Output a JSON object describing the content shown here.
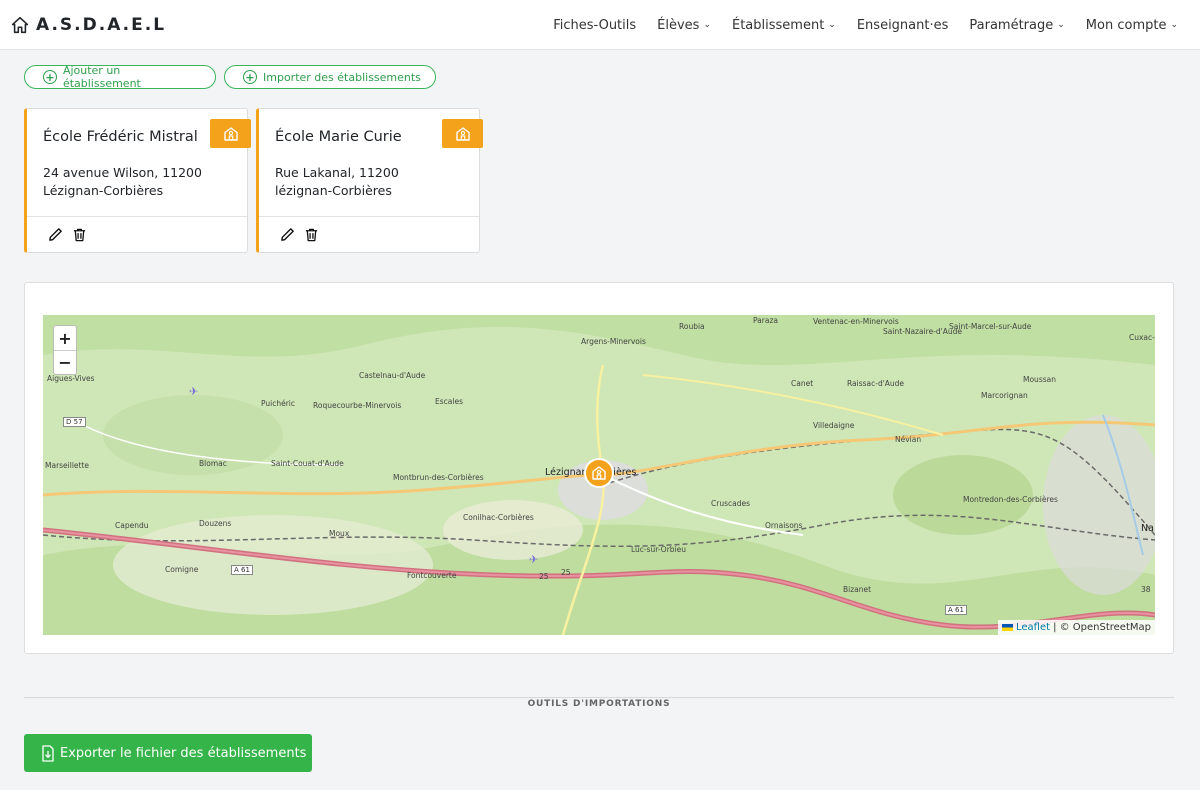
{
  "brand": {
    "title": "A.S.D.A.E.L"
  },
  "nav": [
    {
      "label": "Fiches-Outils",
      "dropdown": false
    },
    {
      "label": "Élèves",
      "dropdown": true
    },
    {
      "label": "Établissement",
      "dropdown": true
    },
    {
      "label": "Enseignant·es",
      "dropdown": false
    },
    {
      "label": "Paramétrage",
      "dropdown": true
    },
    {
      "label": "Mon compte",
      "dropdown": true
    }
  ],
  "actions": {
    "add_label": "Ajouter un établissement",
    "import_label": "Importer des établissements"
  },
  "schools": [
    {
      "name": "École Frédéric Mistral",
      "address": "24 avenue Wilson, 11200 Lézignan-Corbières"
    },
    {
      "name": "École Marie Curie",
      "address": "Rue Lakanal, 11200 lézignan-Corbières"
    }
  ],
  "map": {
    "zoom_in": "+",
    "zoom_out": "−",
    "attribution_link": "Leaflet",
    "attribution_text": "| © OpenStreetMap",
    "places": [
      "Roubia",
      "Argens-Minervois",
      "Ventenac-en-Minervois",
      "Paraza",
      "Saint-Nazaire-d'Aude",
      "Saint-Marcel-sur-Aude",
      "Cuxac-",
      "Aigues-Vives",
      "Castelnau-d'Aude",
      "Puichéric",
      "Roquecourbe-Minervois",
      "Escales",
      "Canet",
      "Raissac-d'Aude",
      "Moussan",
      "Marcorignan",
      "Villedaigne",
      "Névian",
      "Marseillette",
      "Blomac",
      "Saint-Couat-d'Aude",
      "Montbrun-des-Corbières",
      "Lézignan-Corbières",
      "Cruscades",
      "Ornaisons",
      "Montredon-des-Corbières",
      "Conilhac-Corbières",
      "Capendu",
      "Douzens",
      "Moux",
      "Luc-sur-Orbieu",
      "Comigne",
      "Fontcouverte",
      "Bizanet",
      "Na"
    ],
    "road_labels": [
      "D 57",
      "A 61",
      "A 61",
      "25",
      "25",
      "38"
    ]
  },
  "import_section": {
    "title": "OUTILS D'IMPORTATIONS"
  },
  "export": {
    "label": "Exporter le fichier des établissements"
  },
  "colors": {
    "accent": "#f4a21c",
    "success": "#34b449",
    "outline_green": "#3cb55a"
  }
}
